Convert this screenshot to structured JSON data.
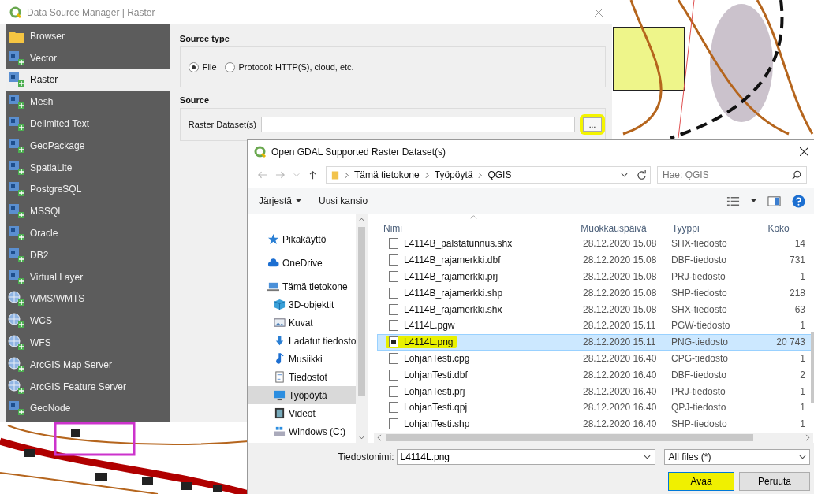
{
  "data_source_manager": {
    "title": "Data Source Manager | Raster",
    "sidebar": {
      "items": [
        {
          "label": "Browser",
          "kind": "folder",
          "selected": false
        },
        {
          "label": "Vector",
          "kind": "layer",
          "selected": false
        },
        {
          "label": "Raster",
          "kind": "layer",
          "selected": true
        },
        {
          "label": "Mesh",
          "kind": "layer",
          "selected": false
        },
        {
          "label": "Delimited Text",
          "kind": "layer",
          "selected": false
        },
        {
          "label": "GeoPackage",
          "kind": "layer",
          "selected": false
        },
        {
          "label": "SpatiaLite",
          "kind": "layer",
          "selected": false
        },
        {
          "label": "PostgreSQL",
          "kind": "layer",
          "selected": false
        },
        {
          "label": "MSSQL",
          "kind": "layer",
          "selected": false
        },
        {
          "label": "Oracle",
          "kind": "layer",
          "selected": false
        },
        {
          "label": "DB2",
          "kind": "layer",
          "selected": false
        },
        {
          "label": "Virtual Layer",
          "kind": "layer",
          "selected": false
        },
        {
          "label": "WMS/WMTS",
          "kind": "globe",
          "selected": false
        },
        {
          "label": "WCS",
          "kind": "globe",
          "selected": false
        },
        {
          "label": "WFS",
          "kind": "globe",
          "selected": false
        },
        {
          "label": "ArcGIS Map Server",
          "kind": "globe",
          "selected": false
        },
        {
          "label": "ArcGIS Feature Server",
          "kind": "globe",
          "selected": false
        },
        {
          "label": "GeoNode",
          "kind": "layer",
          "selected": false
        }
      ]
    },
    "source_type": {
      "heading": "Source type",
      "options": [
        {
          "label": "File",
          "selected": true
        },
        {
          "label": "Protocol: HTTP(S), cloud, etc.",
          "selected": false
        }
      ]
    },
    "source": {
      "heading": "Source",
      "field_label": "Raster Dataset(s)",
      "browse_button": {
        "label": "...",
        "highlighted": true
      }
    }
  },
  "open_dialog": {
    "title": "Open GDAL Supported Raster Dataset(s)",
    "breadcrumb": [
      "Tämä tietokone",
      "Työpöytä",
      "QGIS"
    ],
    "search": {
      "placeholder": "Hae: QGIS"
    },
    "toolbar": {
      "organize": "Järjestä",
      "new_folder": "Uusi kansio"
    },
    "navigation": [
      {
        "label": "Pikakäyttö",
        "kind": "star",
        "selected": false
      },
      {
        "label": "OneDrive",
        "kind": "cloud",
        "selected": false
      },
      {
        "label": "Tämä tietokone",
        "kind": "computer",
        "selected": false,
        "children": [
          {
            "label": "3D-objektit",
            "kind": "cube",
            "selected": false
          },
          {
            "label": "Kuvat",
            "kind": "picture",
            "selected": false
          },
          {
            "label": "Ladatut tiedosto",
            "kind": "download",
            "selected": false
          },
          {
            "label": "Musiikki",
            "kind": "music",
            "selected": false
          },
          {
            "label": "Tiedostot",
            "kind": "document",
            "selected": false
          },
          {
            "label": "Työpöytä",
            "kind": "desktop",
            "selected": true
          },
          {
            "label": "Videot",
            "kind": "video",
            "selected": false
          },
          {
            "label": "Windows (C:)",
            "kind": "drive",
            "selected": false
          }
        ]
      }
    ],
    "columns": [
      "Nimi",
      "Muokkauspäivä",
      "Tyyppi",
      "Koko"
    ],
    "rows": [
      {
        "name": "L4114B_palstatunnus.shx",
        "date": "28.12.2020 15.08",
        "type": "SHX-tiedosto",
        "size": "14",
        "kind": "file",
        "selected": false,
        "highlighted": false
      },
      {
        "name": "L4114B_rajamerkki.dbf",
        "date": "28.12.2020 15.08",
        "type": "DBF-tiedosto",
        "size": "731",
        "kind": "file",
        "selected": false,
        "highlighted": false
      },
      {
        "name": "L4114B_rajamerkki.prj",
        "date": "28.12.2020 15.08",
        "type": "PRJ-tiedosto",
        "size": "1",
        "kind": "file",
        "selected": false,
        "highlighted": false
      },
      {
        "name": "L4114B_rajamerkki.shp",
        "date": "28.12.2020 15.08",
        "type": "SHP-tiedosto",
        "size": "218",
        "kind": "file",
        "selected": false,
        "highlighted": false
      },
      {
        "name": "L4114B_rajamerkki.shx",
        "date": "28.12.2020 15.08",
        "type": "SHX-tiedosto",
        "size": "63",
        "kind": "file",
        "selected": false,
        "highlighted": false
      },
      {
        "name": "L4114L.pgw",
        "date": "28.12.2020 15.11",
        "type": "PGW-tiedosto",
        "size": "1",
        "kind": "file",
        "selected": false,
        "highlighted": false
      },
      {
        "name": "L4114L.png",
        "date": "28.12.2020 15.11",
        "type": "PNG-tiedosto",
        "size": "20 743",
        "kind": "image",
        "selected": true,
        "highlighted": true
      },
      {
        "name": "LohjanTesti.cpg",
        "date": "28.12.2020 16.40",
        "type": "CPG-tiedosto",
        "size": "1",
        "kind": "file",
        "selected": false,
        "highlighted": false
      },
      {
        "name": "LohjanTesti.dbf",
        "date": "28.12.2020 16.40",
        "type": "DBF-tiedosto",
        "size": "2",
        "kind": "file",
        "selected": false,
        "highlighted": false
      },
      {
        "name": "LohjanTesti.prj",
        "date": "28.12.2020 16.40",
        "type": "PRJ-tiedosto",
        "size": "1",
        "kind": "file",
        "selected": false,
        "highlighted": false
      },
      {
        "name": "LohjanTesti.qpj",
        "date": "28.12.2020 16.40",
        "type": "QPJ-tiedosto",
        "size": "1",
        "kind": "file",
        "selected": false,
        "highlighted": false
      },
      {
        "name": "LohjanTesti.shp",
        "date": "28.12.2020 16.40",
        "type": "SHP-tiedosto",
        "size": "1",
        "kind": "file",
        "selected": false,
        "highlighted": false
      }
    ],
    "file_name": {
      "label": "Tiedostonimi:",
      "value": "L4114L.png"
    },
    "file_filter": "All files (*)",
    "buttons": [
      {
        "label": "Avaa",
        "highlighted": true
      },
      {
        "label": "Peruuta",
        "highlighted": false
      }
    ]
  }
}
